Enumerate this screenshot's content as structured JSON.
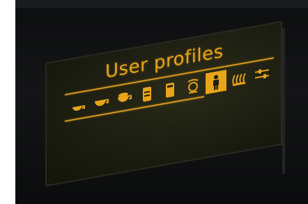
{
  "display": {
    "title": "User profiles",
    "accent_color": "#e8a41a",
    "icons": [
      {
        "name": "espresso-cup-icon",
        "selected": false
      },
      {
        "name": "coffee-cup-icon",
        "selected": false
      },
      {
        "name": "cappuccino-cup-icon",
        "selected": false
      },
      {
        "name": "latte-glass-icon",
        "selected": false
      },
      {
        "name": "milk-glass-icon",
        "selected": false
      },
      {
        "name": "barista-icon",
        "selected": false
      },
      {
        "name": "user-icon",
        "selected": true
      },
      {
        "name": "steam-icon",
        "selected": false
      },
      {
        "name": "settings-sliders-icon",
        "selected": false
      }
    ]
  }
}
